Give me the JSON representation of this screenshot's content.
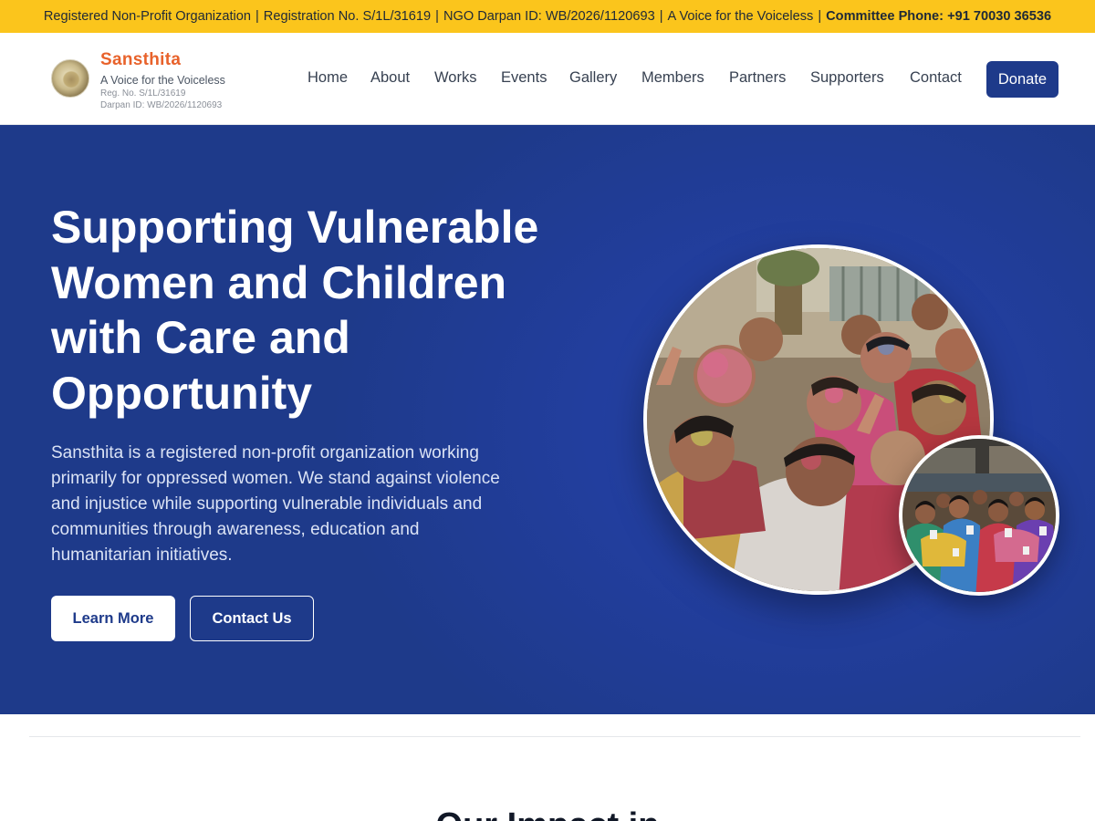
{
  "topbar": {
    "org_type": "Registered Non-Profit Organization",
    "registration": "Registration No. S/1L/31619",
    "darpan": "NGO Darpan ID: WB/2026/1120693",
    "motto": "A Voice for the Voiceless",
    "phone": "Committee Phone: +91 70030 36536",
    "separator": "|"
  },
  "header": {
    "brand_name": "Sansthita",
    "tagline": "A Voice for the Voiceless",
    "reg_no": "Reg. No. S/1L/31619",
    "darpan_id": "Darpan ID: WB/2026/1120693",
    "nav": [
      "Home",
      "About",
      "Works",
      "Events",
      "Gallery",
      "Members",
      "Partners",
      "Supporters",
      "Contact"
    ],
    "donate_label": "Donate"
  },
  "hero": {
    "title": "Supporting Vulnerable Women and Children with Care and Opportunity",
    "description": "Sansthita is a registered non-profit organization working primarily for oppressed women. We stand against violence and injustice while supporting vulnerable individuals and communities through awareness, education and humanitarian initiatives.",
    "primary_button": "Learn More",
    "secondary_button": "Contact Us"
  },
  "next_section": {
    "heading": "Our Impact in"
  },
  "colors": {
    "topbar_bg": "#fbc51c",
    "brand_orange": "#e8622b",
    "primary_blue": "#1e3a8a"
  }
}
